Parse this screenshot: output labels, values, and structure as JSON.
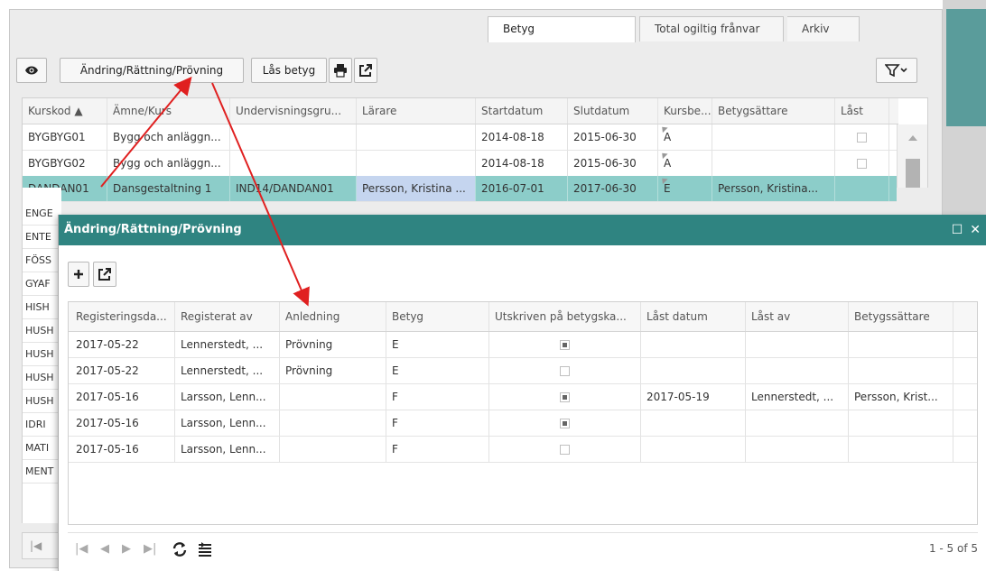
{
  "tabs": [
    {
      "label": "Betyg",
      "active": true
    },
    {
      "label": "Total ogiltig frånvar",
      "active": false
    },
    {
      "label": "Arkiv",
      "active": false
    }
  ],
  "toolbar": {
    "eye_icon": "eye-icon",
    "change_button": "Ändring/Rättning/Prövning",
    "lock_button": "Lås betyg",
    "print_icon": "printer-icon",
    "export_icon": "export-icon",
    "filter_icon": "filter-icon"
  },
  "main_grid": {
    "columns": [
      "Kurskod ▲",
      "Ämne/Kurs",
      "Undervisningsgru...",
      "Lärare",
      "Startdatum",
      "Slutdatum",
      "Kursbe...",
      "Betygsättare",
      "Låst"
    ],
    "rows": [
      {
        "kurskod": "BYGBYG01",
        "amne": "Bygg och anläggn...",
        "grupp": "",
        "larare": "",
        "start": "2014-08-18",
        "slut": "2015-06-30",
        "kursbetyg": "A",
        "betygsattare": "",
        "last": false,
        "selected": false
      },
      {
        "kurskod": "BYGBYG02",
        "amne": "Bygg och anläggn...",
        "grupp": "",
        "larare": "",
        "start": "2014-08-18",
        "slut": "2015-06-30",
        "kursbetyg": "A",
        "betygsattare": "",
        "last": false,
        "selected": false
      },
      {
        "kurskod": "DANDAN01",
        "amne": "Dansgestaltning 1",
        "grupp": "IND14/DANDAN01",
        "larare": "Persson, Kristina ...",
        "start": "2016-07-01",
        "slut": "2017-06-30",
        "kursbetyg": "E",
        "betygsattare": "Persson, Kristina...",
        "last": false,
        "selected": true
      }
    ],
    "hidden_row_stubs": [
      "ENGE",
      "ENTE",
      "FÖSS",
      "GYAF",
      "HISH",
      "HUSH",
      "HUSH",
      "HUSH",
      "HUSH",
      "IDRI",
      "MATI",
      "MENT"
    ]
  },
  "modal": {
    "title": "Ändring/Rättning/Prövning",
    "maximize_icon": "maximize-icon",
    "close_icon": "close-icon",
    "add_icon": "plus-icon",
    "export_icon": "export-icon",
    "columns": [
      "Registeringsda...",
      "Registerat av",
      "Anledning",
      "Betyg",
      "Utskriven på betygska...",
      "Låst datum",
      "Låst av",
      "Betygssättare"
    ],
    "rows": [
      {
        "datum": "2017-05-22",
        "av": "Lennerstedt, ...",
        "anledning": "Prövning",
        "betyg": "E",
        "utskriven": true,
        "last_datum": "",
        "last_av": "",
        "betygssattare": ""
      },
      {
        "datum": "2017-05-22",
        "av": "Lennerstedt, ...",
        "anledning": "Prövning",
        "betyg": "E",
        "utskriven": false,
        "last_datum": "",
        "last_av": "",
        "betygssattare": ""
      },
      {
        "datum": "2017-05-16",
        "av": "Larsson, Lenn...",
        "anledning": "",
        "betyg": "F",
        "utskriven": true,
        "last_datum": "2017-05-19",
        "last_av": "Lennerstedt, ...",
        "betygssattare": "Persson, Krist..."
      },
      {
        "datum": "2017-05-16",
        "av": "Larsson, Lenn...",
        "anledning": "",
        "betyg": "F",
        "utskriven": true,
        "last_datum": "",
        "last_av": "",
        "betygssattare": ""
      },
      {
        "datum": "2017-05-16",
        "av": "Larsson, Lenn...",
        "anledning": "",
        "betyg": "F",
        "utskriven": false,
        "last_datum": "",
        "last_av": "",
        "betygssattare": ""
      }
    ],
    "pager_info": "1 - 5 of 5"
  },
  "colors": {
    "header_teal": "#2f8481",
    "selected_row": "#8ccdc9",
    "annotation_arrow": "#e02020"
  }
}
